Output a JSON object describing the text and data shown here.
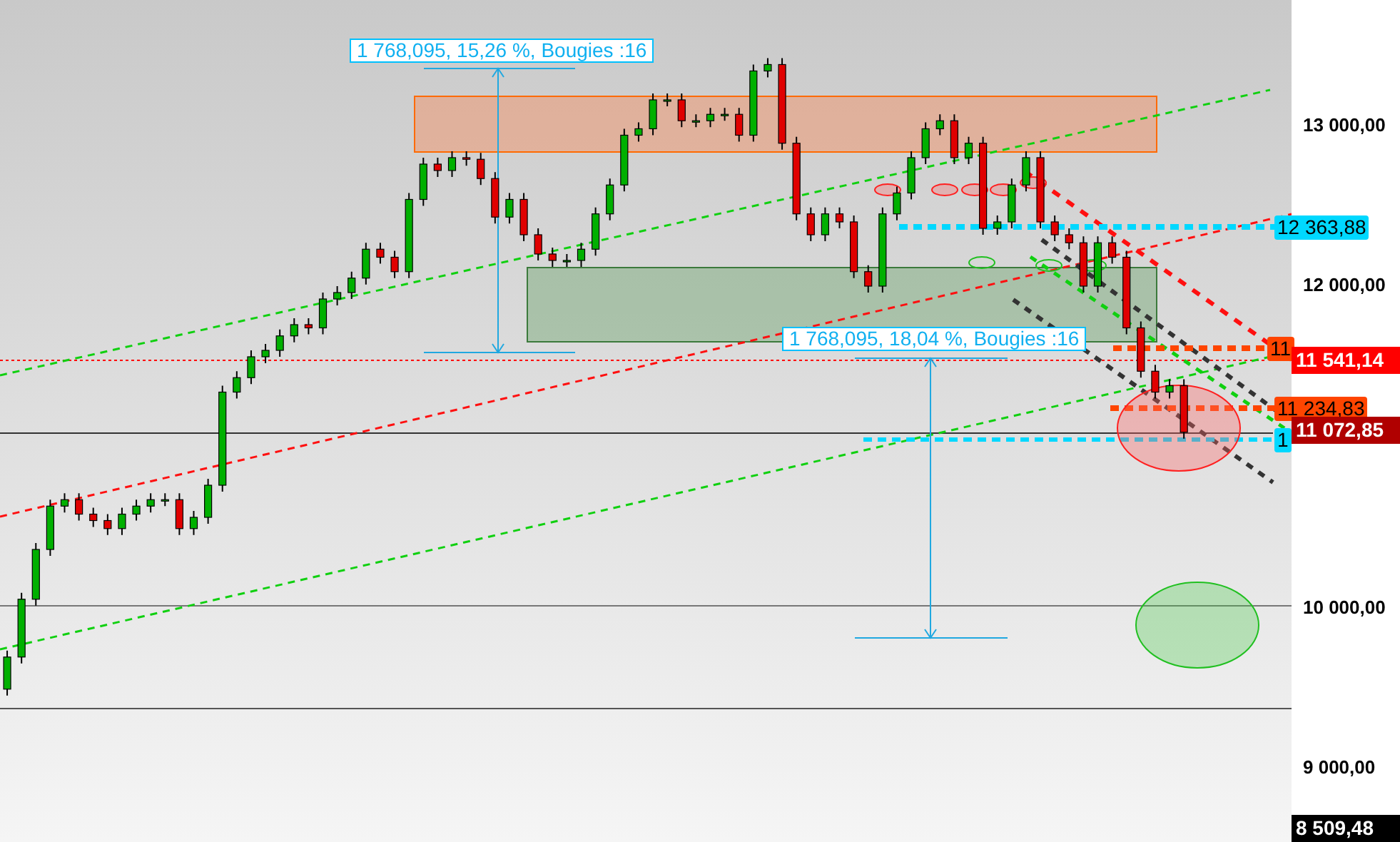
{
  "chart_data": {
    "type": "candlestick",
    "ylim": [
      8538,
      13782
    ],
    "yticks": [
      {
        "value": 13000,
        "label": "13 000,00"
      },
      {
        "value": 12000,
        "label": "12 000,00"
      },
      {
        "value": 10000,
        "label": "10 000,00"
      },
      {
        "value": 9000,
        "label": "9 000,00"
      }
    ],
    "categories": [
      null,
      null,
      null,
      null,
      null,
      null,
      null,
      null,
      null,
      null,
      null,
      null,
      null,
      null,
      null,
      null,
      null,
      null,
      null,
      null,
      null,
      null,
      null,
      null,
      null,
      null,
      null,
      null,
      null,
      null,
      null,
      null,
      null,
      null,
      null,
      null,
      null,
      null,
      null,
      null,
      null,
      null,
      null,
      null,
      null,
      null,
      null,
      null,
      null,
      null,
      null,
      null,
      null,
      null,
      null,
      null,
      null,
      null,
      null,
      null,
      null,
      null,
      null,
      null,
      null,
      null,
      null,
      null,
      null,
      null,
      null,
      null,
      null,
      null,
      null,
      null,
      null,
      null,
      null,
      null,
      null,
      null,
      null,
      null,
      null,
      null,
      null,
      null,
      null,
      null
    ],
    "ohlc": [
      [
        9490,
        9730,
        9450,
        9690
      ],
      [
        9690,
        10090,
        9650,
        10050
      ],
      [
        10050,
        10400,
        10010,
        10360
      ],
      [
        10360,
        10670,
        10320,
        10630
      ],
      [
        10630,
        10710,
        10590,
        10670
      ],
      [
        10670,
        10710,
        10540,
        10580
      ],
      [
        10580,
        10620,
        10500,
        10540
      ],
      [
        10540,
        10580,
        10450,
        10490
      ],
      [
        10490,
        10620,
        10450,
        10580
      ],
      [
        10580,
        10670,
        10540,
        10630
      ],
      [
        10630,
        10710,
        10590,
        10670
      ],
      [
        10670,
        10710,
        10630,
        10670
      ],
      [
        10670,
        10710,
        10450,
        10490
      ],
      [
        10490,
        10600,
        10450,
        10560
      ],
      [
        10560,
        10800,
        10520,
        10760
      ],
      [
        10760,
        11380,
        10720,
        11340
      ],
      [
        11340,
        11470,
        11300,
        11430
      ],
      [
        11430,
        11600,
        11390,
        11560
      ],
      [
        11560,
        11640,
        11520,
        11600
      ],
      [
        11600,
        11730,
        11560,
        11690
      ],
      [
        11690,
        11800,
        11650,
        11760
      ],
      [
        11760,
        11800,
        11700,
        11740
      ],
      [
        11740,
        11960,
        11700,
        11920
      ],
      [
        11920,
        12000,
        11880,
        11960
      ],
      [
        11960,
        12090,
        11920,
        12050
      ],
      [
        12050,
        12270,
        12010,
        12230
      ],
      [
        12230,
        12270,
        12140,
        12180
      ],
      [
        12180,
        12220,
        12050,
        12090
      ],
      [
        12090,
        12580,
        12050,
        12540
      ],
      [
        12540,
        12800,
        12500,
        12760
      ],
      [
        12760,
        12800,
        12680,
        12720
      ],
      [
        12720,
        12840,
        12680,
        12800
      ],
      [
        12800,
        12840,
        12750,
        12790
      ],
      [
        12790,
        12830,
        12630,
        12670
      ],
      [
        12670,
        12710,
        12390,
        12430
      ],
      [
        12430,
        12580,
        12390,
        12540
      ],
      [
        12540,
        12580,
        12280,
        12320
      ],
      [
        12320,
        12360,
        12160,
        12200
      ],
      [
        12200,
        12240,
        12120,
        12160
      ],
      [
        12160,
        12200,
        12120,
        12160
      ],
      [
        12160,
        12270,
        12120,
        12230
      ],
      [
        12230,
        12490,
        12190,
        12450
      ],
      [
        12450,
        12670,
        12410,
        12630
      ],
      [
        12630,
        12980,
        12590,
        12940
      ],
      [
        12940,
        13020,
        12900,
        12980
      ],
      [
        12980,
        13200,
        12940,
        13160
      ],
      [
        13160,
        13200,
        13120,
        13160
      ],
      [
        13160,
        13200,
        12990,
        13030
      ],
      [
        13030,
        13070,
        12990,
        13030
      ],
      [
        13030,
        13110,
        12990,
        13070
      ],
      [
        13070,
        13110,
        13030,
        13070
      ],
      [
        13070,
        13110,
        12900,
        12940
      ],
      [
        12940,
        13380,
        12900,
        13340
      ],
      [
        13340,
        13420,
        13300,
        13380
      ],
      [
        13380,
        13420,
        12850,
        12890
      ],
      [
        12890,
        12930,
        12410,
        12450
      ],
      [
        12450,
        12490,
        12280,
        12320
      ],
      [
        12320,
        12490,
        12280,
        12450
      ],
      [
        12450,
        12490,
        12360,
        12400
      ],
      [
        12400,
        12440,
        12050,
        12090
      ],
      [
        12090,
        12130,
        11960,
        12000
      ],
      [
        12000,
        12490,
        11960,
        12450
      ],
      [
        12450,
        12620,
        12410,
        12580
      ],
      [
        12580,
        12840,
        12540,
        12800
      ],
      [
        12800,
        13020,
        12760,
        12980
      ],
      [
        12980,
        13070,
        12940,
        13030
      ],
      [
        13030,
        13070,
        12760,
        12800
      ],
      [
        12800,
        12930,
        12760,
        12890
      ],
      [
        12890,
        12930,
        12320,
        12360
      ],
      [
        12360,
        12440,
        12320,
        12400
      ],
      [
        12400,
        12670,
        12360,
        12630
      ],
      [
        12630,
        12840,
        12590,
        12800
      ],
      [
        12800,
        12840,
        12360,
        12400
      ],
      [
        12400,
        12440,
        12280,
        12320
      ],
      [
        12320,
        12360,
        12230,
        12270
      ],
      [
        12270,
        12310,
        11960,
        12000
      ],
      [
        12000,
        12310,
        11960,
        12270
      ],
      [
        12270,
        12310,
        12140,
        12180
      ],
      [
        12180,
        12220,
        11700,
        11740
      ],
      [
        11740,
        11780,
        11430,
        11470
      ],
      [
        11470,
        11510,
        11300,
        11340
      ],
      [
        11340,
        11420,
        11300,
        11380
      ],
      [
        11380,
        11420,
        11050,
        11090
      ],
      null,
      null,
      null,
      null,
      null,
      null,
      null
    ],
    "annotations": [
      {
        "text": "1 768,095, 15,26 %, Bougies :16"
      },
      {
        "text": "1 768,095, 18,04 %, Bougies :16"
      }
    ]
  },
  "price_tags": [
    {
      "text": "12 363,88",
      "color": "#00d8ff",
      "kind": "line"
    },
    {
      "text": "11",
      "color": "#ff4500",
      "kind": "line"
    },
    {
      "text": "11 541,14",
      "color": "#ff0000",
      "kind": "axis"
    },
    {
      "text": "11 234,83",
      "color": "#ff4500",
      "kind": "line"
    },
    {
      "text": "1",
      "color": "#00d8ff",
      "kind": "line"
    },
    {
      "text": "11 072,85",
      "color": "#b00000",
      "kind": "axis"
    },
    {
      "text": "8 509,48",
      "color": "#000000",
      "kind": "axis"
    }
  ]
}
